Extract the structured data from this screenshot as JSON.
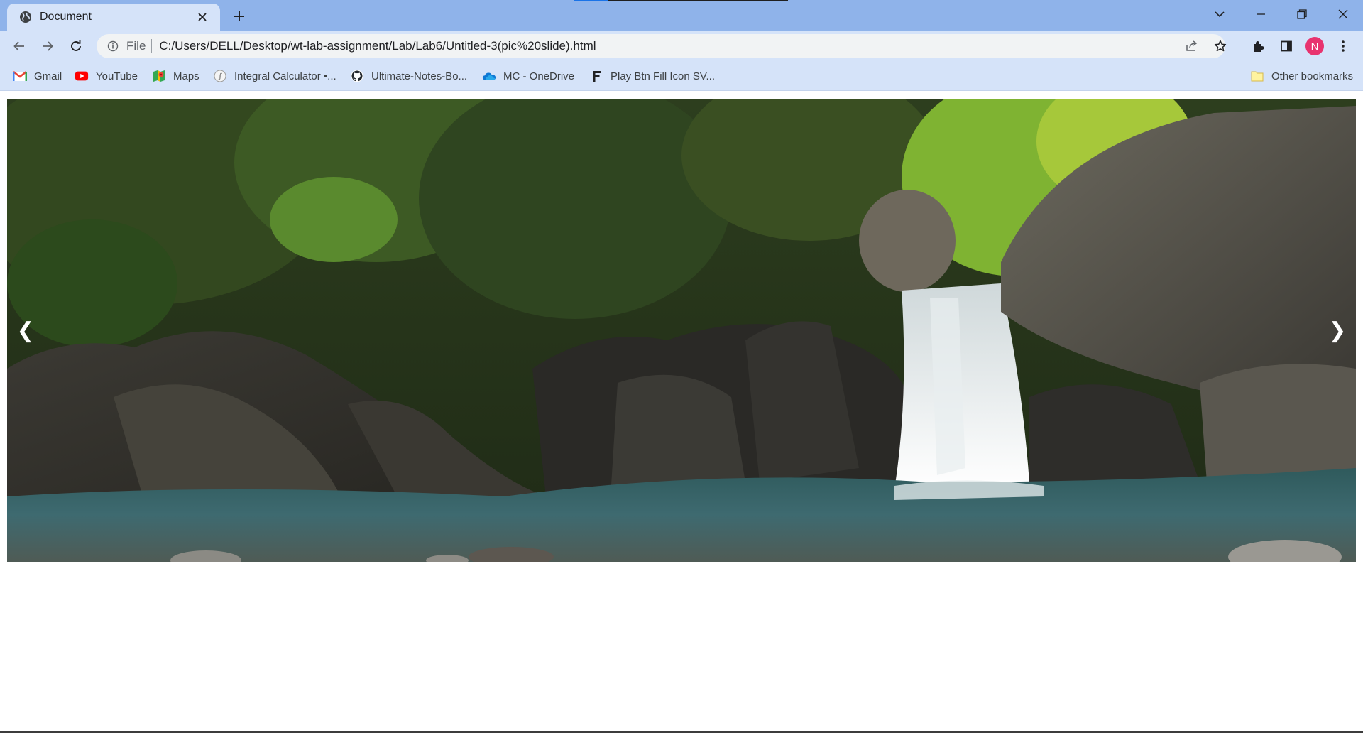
{
  "tab": {
    "title": "Document",
    "favicon": "globe-icon"
  },
  "window_controls": [
    "tab-search-icon",
    "minimize-icon",
    "restore-icon",
    "close-icon"
  ],
  "loading_progress": 0.16,
  "toolbar": {
    "file_label": "File",
    "url": "C:/Users/DELL/Desktop/wt-lab-assignment/Lab/Lab6/Untitled-3(pic%20slide).html",
    "profile_initial": "N"
  },
  "bookmarks": [
    {
      "label": "Gmail",
      "icon": "gmail-icon"
    },
    {
      "label": "YouTube",
      "icon": "youtube-icon"
    },
    {
      "label": "Maps",
      "icon": "maps-icon"
    },
    {
      "label": "Integral Calculator •...",
      "icon": "calculator-icon"
    },
    {
      "label": "Ultimate-Notes-Bo...",
      "icon": "github-icon"
    },
    {
      "label": "MC - OneDrive",
      "icon": "onedrive-icon"
    },
    {
      "label": "Play Btn Fill Icon SV...",
      "icon": "f-letter-icon"
    }
  ],
  "other_bookmarks": "Other bookmarks",
  "slideshow": {
    "prev": "❮",
    "next": "❯"
  },
  "colors": {
    "tabstrip": "#8fb3ea",
    "toolbar": "#d5e3f9",
    "avatar": "#e8336f",
    "water": "#3e6a70"
  }
}
